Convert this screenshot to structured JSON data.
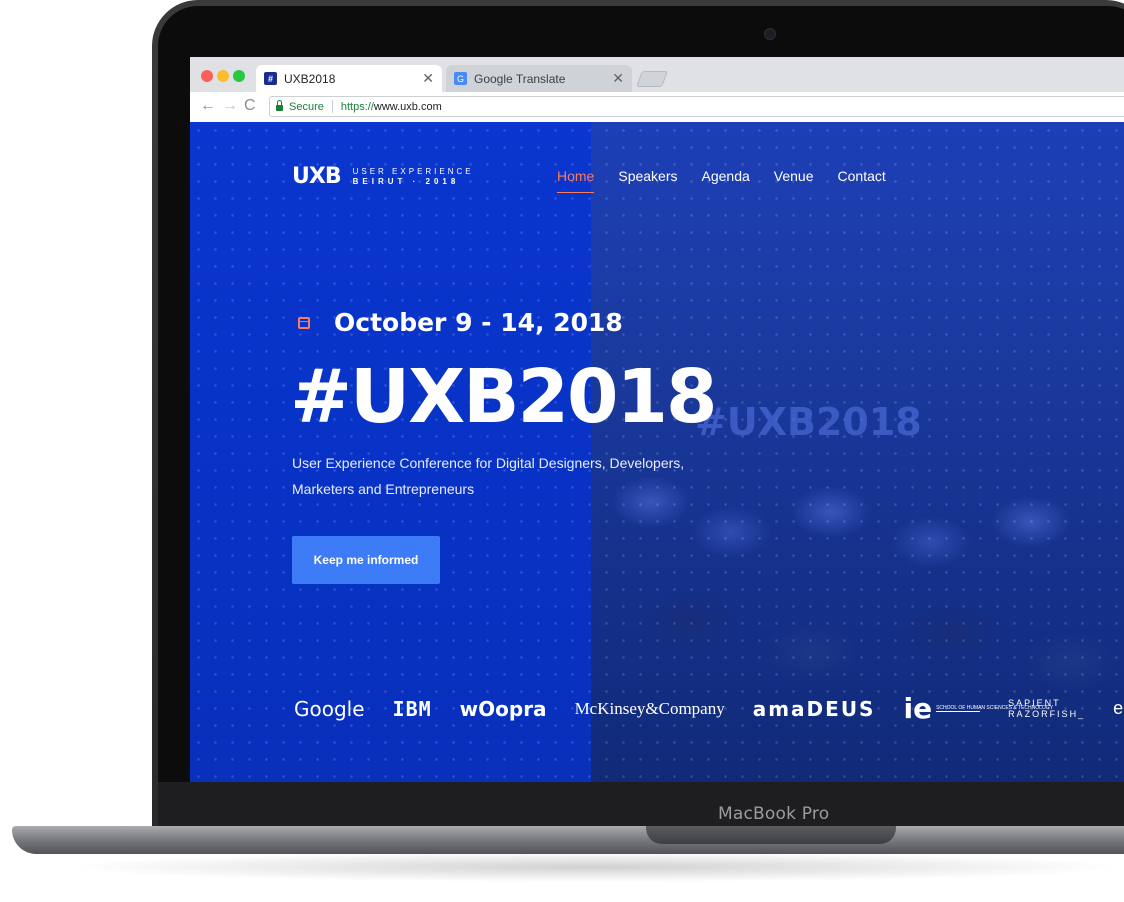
{
  "device": {
    "label": "MacBook Pro"
  },
  "browser": {
    "tabs": [
      {
        "label": "UXB2018",
        "favicon": "#",
        "active": true
      },
      {
        "label": "Google Translate",
        "favicon": "translate-icon",
        "active": false
      }
    ],
    "close_glyph": "✕",
    "nav": {
      "back": "←",
      "forward": "→",
      "reload": "C"
    },
    "address": {
      "secure_label": "Secure",
      "scheme": "https://",
      "host": "www.uxb.com"
    }
  },
  "site": {
    "logo": {
      "mark": "UXB",
      "line1": "USER EXPERIENCE",
      "line2": "BEIRUT · 2018"
    },
    "nav": [
      {
        "label": "Home",
        "active": true
      },
      {
        "label": "Speakers"
      },
      {
        "label": "Agenda"
      },
      {
        "label": "Venue"
      },
      {
        "label": "Contact"
      }
    ],
    "hero": {
      "date": "October 9 - 14, 2018",
      "title": "#UXB2018",
      "ghost_title": "#UXB2018",
      "subtitle": "User Experience Conference for Digital Designers, Developers, Marketers and Entrepreneurs",
      "cta": "Keep me informed"
    },
    "sponsors": {
      "google": "Google",
      "ibm": "IBM",
      "woopra": "wOopra",
      "mckinsey": "McKinsey&Company",
      "amadeus": "amaDEUS",
      "ie_big": "ie",
      "ie_small": "SCHOOL OF HUMAN SCIENCES & TECHNOLOGY",
      "sapient_1": "SAPIENT",
      "sapient_2": "RAZORFISH_",
      "eb": "eb"
    }
  },
  "colors": {
    "primary_blue": "#0b36cf",
    "accent_orange": "#ff7a59",
    "button_blue": "#3d7bf7"
  }
}
